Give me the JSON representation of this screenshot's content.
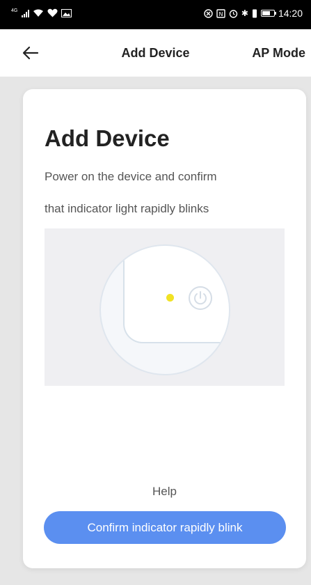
{
  "status_bar": {
    "network_label": "4G",
    "time": "14:20",
    "icons": [
      "signal-icon",
      "wifi-icon",
      "heart-rate-icon",
      "image-icon",
      "nfc-icon",
      "alarm-icon",
      "bluetooth-icon",
      "vibrate-icon",
      "battery-icon"
    ]
  },
  "nav": {
    "back_icon": "arrow-left-icon",
    "title": "Add Device",
    "right_action": "AP Mode"
  },
  "card": {
    "title": "Add Device",
    "description_line1": "Power on the device and confirm",
    "description_line2": "that indicator light rapidly blinks",
    "illustration": {
      "indicator_color": "#f1e224",
      "icons": [
        "indicator-light-icon",
        "power-icon"
      ]
    },
    "help_label": "Help",
    "confirm_label": "Confirm indicator rapidly blink"
  },
  "colors": {
    "accent": "#5b8ff0",
    "page_background": "#e6e6e6",
    "indicator": "#f1e224"
  }
}
